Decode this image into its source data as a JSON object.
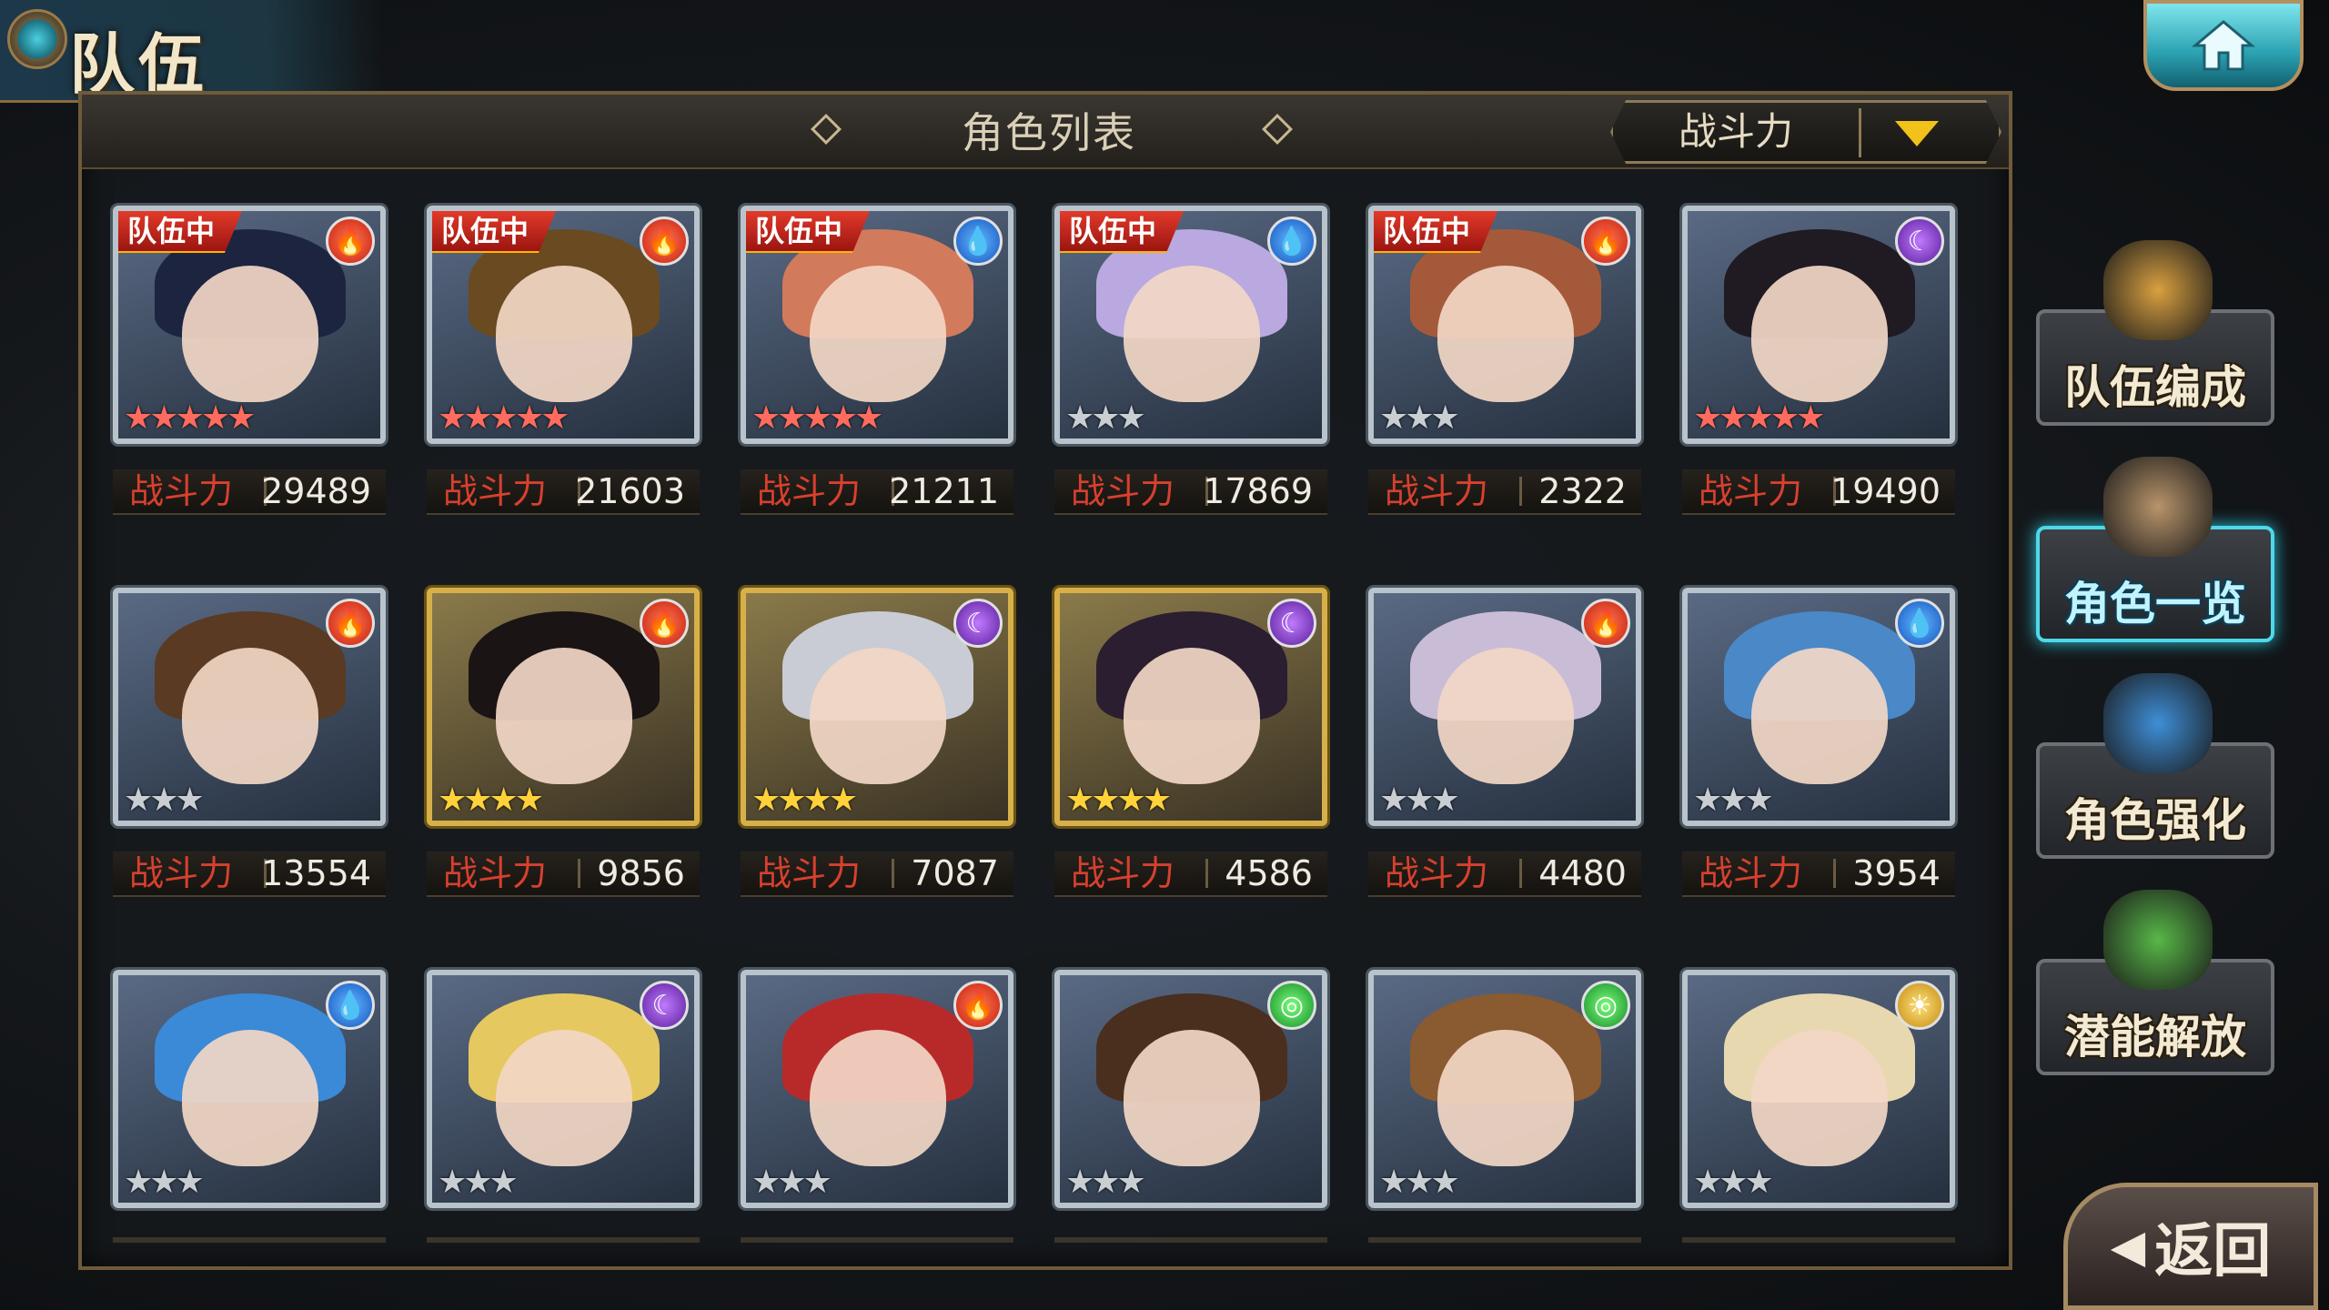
{
  "header": {
    "title": "队伍"
  },
  "panel": {
    "title": "角色列表",
    "sort_label": "战斗力"
  },
  "power_label": "战斗力",
  "team_tag": "队伍中",
  "characters": [
    {
      "team": true,
      "element": "fire",
      "stars": "★★★★★",
      "star_type": "rainbow",
      "frame": "silver",
      "power": "29489",
      "hair": "#1c2440"
    },
    {
      "team": true,
      "element": "fire",
      "stars": "★★★★★",
      "star_type": "rainbow",
      "frame": "silver",
      "power": "21603",
      "hair": "#6a4a20"
    },
    {
      "team": true,
      "element": "water",
      "stars": "★★★★★",
      "star_type": "rainbow",
      "frame": "silver",
      "power": "21211",
      "hair": "#d27a5c"
    },
    {
      "team": true,
      "element": "water",
      "stars": "★★★",
      "star_type": "gray",
      "frame": "silver",
      "power": "17869",
      "hair": "#b9a9e0"
    },
    {
      "team": true,
      "element": "fire",
      "stars": "★★★",
      "star_type": "gray",
      "frame": "silver",
      "power": "2322",
      "hair": "#a45a3a"
    },
    {
      "team": false,
      "element": "dark",
      "stars": "★★★★★",
      "star_type": "rainbow",
      "frame": "silver",
      "power": "19490",
      "hair": "#201a22"
    },
    {
      "team": false,
      "element": "fire",
      "stars": "★★★",
      "star_type": "gray",
      "frame": "silver",
      "power": "13554",
      "hair": "#5a3a22"
    },
    {
      "team": false,
      "element": "fire",
      "stars": "★★★★",
      "star_type": "gold",
      "frame": "gold",
      "power": "9856",
      "hair": "#1a1414"
    },
    {
      "team": false,
      "element": "dark",
      "stars": "★★★★",
      "star_type": "gold",
      "frame": "gold",
      "power": "7087",
      "hair": "#c9ccd4"
    },
    {
      "team": false,
      "element": "dark",
      "stars": "★★★★",
      "star_type": "gold",
      "frame": "gold",
      "power": "4586",
      "hair": "#2a1e30"
    },
    {
      "team": false,
      "element": "fire",
      "stars": "★★★",
      "star_type": "gray",
      "frame": "silver",
      "power": "4480",
      "hair": "#c9bcd6"
    },
    {
      "team": false,
      "element": "water",
      "stars": "★★★",
      "star_type": "gray",
      "frame": "silver",
      "power": "3954",
      "hair": "#4a88c8"
    },
    {
      "team": false,
      "element": "water",
      "stars": "★★★",
      "star_type": "gray",
      "frame": "silver",
      "power": "",
      "hair": "#3b8ad8"
    },
    {
      "team": false,
      "element": "dark",
      "stars": "★★★",
      "star_type": "gray",
      "frame": "silver",
      "power": "",
      "hair": "#e6c860"
    },
    {
      "team": false,
      "element": "fire",
      "stars": "★★★",
      "star_type": "gray",
      "frame": "silver",
      "power": "",
      "hair": "#b82a2a"
    },
    {
      "team": false,
      "element": "wind",
      "stars": "★★★",
      "star_type": "gray",
      "frame": "silver",
      "power": "",
      "hair": "#4a2e1e"
    },
    {
      "team": false,
      "element": "wind",
      "stars": "★★★",
      "star_type": "gray",
      "frame": "silver",
      "power": "",
      "hair": "#8a5a30"
    },
    {
      "team": false,
      "element": "light",
      "stars": "★★★",
      "star_type": "gray",
      "frame": "silver",
      "power": "",
      "hair": "#e8d8b0"
    }
  ],
  "side_menu": [
    {
      "label": "队伍编成",
      "active": false,
      "art_color": "#d9a040"
    },
    {
      "label": "角色一览",
      "active": true,
      "art_color": "#b8946a"
    },
    {
      "label": "角色强化",
      "active": false,
      "art_color": "#3e8fd8"
    },
    {
      "label": "潜能解放",
      "active": false,
      "art_color": "#58b848"
    }
  ],
  "back_label": "返回",
  "icons": {
    "fire": "🔥",
    "water": "💧",
    "dark": "☾",
    "wind": "◎",
    "light": "☀",
    "home": "home-icon",
    "back_arrow": "◀"
  }
}
